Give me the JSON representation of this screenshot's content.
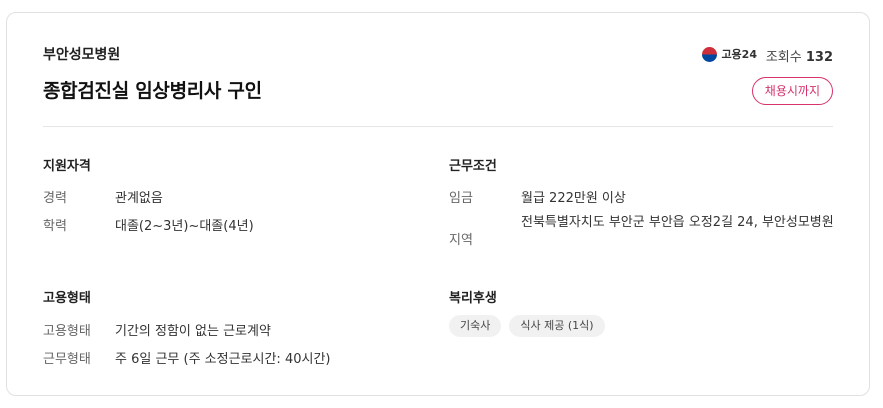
{
  "header": {
    "company": "부안성모병원",
    "title": "종합검진실 임상병리사 구인",
    "source_label": "고용24",
    "views_label": "조회수",
    "views_count": "132",
    "deadline_button": "채용시까지"
  },
  "qualifications": {
    "title": "지원자격",
    "rows": [
      {
        "label": "경력",
        "value": "관계없음"
      },
      {
        "label": "학력",
        "value": "대졸(2~3년)~대졸(4년)"
      }
    ]
  },
  "conditions": {
    "title": "근무조건",
    "rows": [
      {
        "label": "임금",
        "value": "월급 222만원 이상"
      },
      {
        "label": "지역",
        "value": "전북특별자치도 부안군 부안읍 오정2길 24, 부안성모병원"
      }
    ]
  },
  "employment": {
    "title": "고용형태",
    "rows": [
      {
        "label": "고용형태",
        "value": "기간의 정함이 없는 근로계약"
      },
      {
        "label": "근무형태",
        "value": "주 6일 근무 (주 소정근로시간: 40시간)"
      }
    ]
  },
  "benefits": {
    "title": "복리후생",
    "tags": [
      "기숙사",
      "식사 제공 (1식)"
    ]
  },
  "colors": {
    "accent": "#d6336c",
    "border": "#e1e1e1"
  },
  "icons": {
    "source_logo": "taegeuk-logo-icon"
  }
}
